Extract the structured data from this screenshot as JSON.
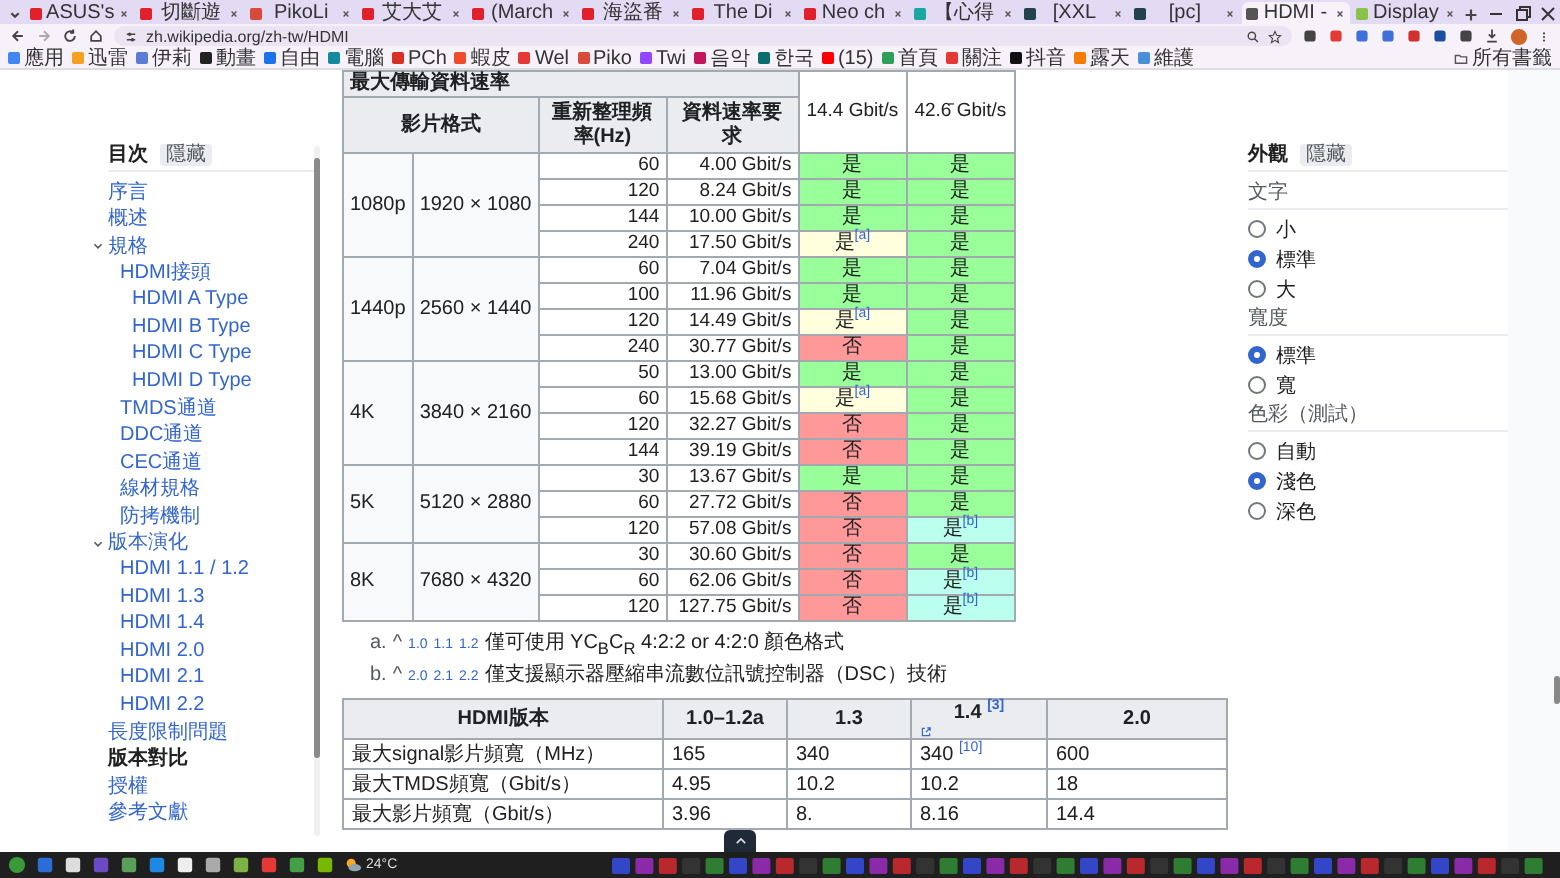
{
  "browser": {
    "tabs": [
      {
        "title": "ASUS's",
        "selected": false,
        "color": "#e0202a"
      },
      {
        "title": "切斷遊",
        "selected": false,
        "color": "#e0202a"
      },
      {
        "title": "PikoLi",
        "selected": false,
        "color": "#d84a3a"
      },
      {
        "title": "艾大艾",
        "selected": false,
        "color": "#e0202a"
      },
      {
        "title": "(March",
        "selected": false,
        "color": "#e0202a"
      },
      {
        "title": "海盜番",
        "selected": false,
        "color": "#e0202a"
      },
      {
        "title": "The Di",
        "selected": false,
        "color": "#e0202a"
      },
      {
        "title": "Neo ch",
        "selected": false,
        "color": "#e0202a"
      },
      {
        "title": "【心得",
        "selected": false,
        "color": "#1aa7a0"
      },
      {
        "title": "[XXL",
        "selected": false,
        "color": "#23424f"
      },
      {
        "title": "[pc]",
        "selected": false,
        "color": "#23424f"
      },
      {
        "title": "HDMI -",
        "selected": true,
        "color": "#555555"
      },
      {
        "title": "Display",
        "selected": false,
        "color": "#8bc34a"
      }
    ],
    "url": "zh.wikipedia.org/zh-tw/HDMI",
    "bookmarks": [
      {
        "label": "應用",
        "color": "#4285f4"
      },
      {
        "label": "迅雷",
        "color": "#f4a020"
      },
      {
        "label": "伊莉",
        "color": "#5b7bd5"
      },
      {
        "label": "動畫",
        "color": "#222222"
      },
      {
        "label": "自由",
        "color": "#1a73e8"
      },
      {
        "label": "電腦",
        "color": "#138a9e"
      },
      {
        "label": "PCh",
        "color": "#d93025"
      },
      {
        "label": "蝦皮",
        "color": "#ee4d2d"
      },
      {
        "label": "Wel",
        "color": "#e53935"
      },
      {
        "label": "Piko",
        "color": "#d84a3a"
      },
      {
        "label": "Twi",
        "color": "#9146ff"
      },
      {
        "label": "음악",
        "color": "#c2185b"
      },
      {
        "label": "한국",
        "color": "#0b6e6e"
      },
      {
        "label": "(15)",
        "color": "#ff0000"
      },
      {
        "label": "首頁",
        "color": "#2e9e5b"
      },
      {
        "label": "關注",
        "color": "#e53935"
      },
      {
        "label": "抖音",
        "color": "#111111"
      },
      {
        "label": "露天",
        "color": "#f57c00"
      },
      {
        "label": "維護",
        "color": "#4a90d9"
      }
    ],
    "all_bookmarks": "所有書籤"
  },
  "toc": {
    "title": "目次",
    "hide_button": "隱藏",
    "items": [
      {
        "label": "序言",
        "selected": false
      },
      {
        "label": "概述",
        "selected": false
      },
      {
        "label": "規格",
        "selected": false,
        "expanded": true,
        "children": [
          {
            "label": "HDMI接頭",
            "selected": false,
            "children": [
              {
                "label": "HDMI A Type",
                "selected": false
              },
              {
                "label": "HDMI B Type",
                "selected": false
              },
              {
                "label": "HDMI C Type",
                "selected": false
              },
              {
                "label": "HDMI D Type",
                "selected": false
              }
            ]
          },
          {
            "label": "TMDS通道",
            "selected": false
          },
          {
            "label": "DDC通道",
            "selected": false
          },
          {
            "label": "CEC通道",
            "selected": false
          },
          {
            "label": "線材規格",
            "selected": false
          },
          {
            "label": "防拷機制",
            "selected": false
          }
        ]
      },
      {
        "label": "版本演化",
        "selected": false,
        "expanded": true,
        "children": [
          {
            "label": "HDMI 1.1 / 1.2",
            "selected": false
          },
          {
            "label": "HDMI 1.3",
            "selected": false
          },
          {
            "label": "HDMI 1.4",
            "selected": false
          },
          {
            "label": "HDMI 2.0",
            "selected": false
          },
          {
            "label": "HDMI 2.1",
            "selected": false
          },
          {
            "label": "HDMI 2.2",
            "selected": false
          }
        ]
      },
      {
        "label": "長度限制問題",
        "selected": false
      },
      {
        "label": "版本對比",
        "selected": true
      },
      {
        "label": "授權",
        "selected": false
      },
      {
        "label": "參考文獻",
        "selected": false
      }
    ]
  },
  "rate_table": {
    "title": "最大傳輸資料速率",
    "format_header": "影片格式",
    "refresh_header": "重新整理頻率(Hz)",
    "rate_header": "資料速率要求",
    "bandwidths": [
      "14.4 Gbit/s",
      "42.6̄ Gbit/s"
    ],
    "groups": [
      {
        "format": "1080p",
        "resolution": "1920 × 1080",
        "rows": [
          {
            "hz": "60",
            "rate": "4.00 Gbit/s",
            "support": [
              {
                "text": "是",
                "color": "#99ff99"
              },
              {
                "text": "是",
                "color": "#99ff99"
              }
            ]
          },
          {
            "hz": "120",
            "rate": "8.24 Gbit/s",
            "support": [
              {
                "text": "是",
                "color": "#99ff99"
              },
              {
                "text": "是",
                "color": "#99ff99"
              }
            ]
          },
          {
            "hz": "144",
            "rate": "10.00 Gbit/s",
            "support": [
              {
                "text": "是",
                "color": "#99ff99"
              },
              {
                "text": "是",
                "color": "#99ff99"
              }
            ]
          },
          {
            "hz": "240",
            "rate": "17.50 Gbit/s",
            "support": [
              {
                "text": "是",
                "ref": "[a]",
                "color": "#ffffdd"
              },
              {
                "text": "是",
                "color": "#99ff99"
              }
            ]
          }
        ]
      },
      {
        "format": "1440p",
        "resolution": "2560 × 1440",
        "rows": [
          {
            "hz": "60",
            "rate": "7.04 Gbit/s",
            "support": [
              {
                "text": "是",
                "color": "#99ff99"
              },
              {
                "text": "是",
                "color": "#99ff99"
              }
            ]
          },
          {
            "hz": "100",
            "rate": "11.96 Gbit/s",
            "support": [
              {
                "text": "是",
                "color": "#99ff99"
              },
              {
                "text": "是",
                "color": "#99ff99"
              }
            ]
          },
          {
            "hz": "120",
            "rate": "14.49 Gbit/s",
            "support": [
              {
                "text": "是",
                "ref": "[a]",
                "color": "#ffffdd"
              },
              {
                "text": "是",
                "color": "#99ff99"
              }
            ]
          },
          {
            "hz": "240",
            "rate": "30.77 Gbit/s",
            "support": [
              {
                "text": "否",
                "color": "#ff9999"
              },
              {
                "text": "是",
                "color": "#99ff99"
              }
            ]
          }
        ]
      },
      {
        "format": "4K",
        "resolution": "3840 × 2160",
        "rows": [
          {
            "hz": "50",
            "rate": "13.00 Gbit/s",
            "support": [
              {
                "text": "是",
                "color": "#99ff99"
              },
              {
                "text": "是",
                "color": "#99ff99"
              }
            ]
          },
          {
            "hz": "60",
            "rate": "15.68 Gbit/s",
            "support": [
              {
                "text": "是",
                "ref": "[a]",
                "color": "#ffffdd"
              },
              {
                "text": "是",
                "color": "#99ff99"
              }
            ]
          },
          {
            "hz": "120",
            "rate": "32.27 Gbit/s",
            "support": [
              {
                "text": "否",
                "color": "#ff9999"
              },
              {
                "text": "是",
                "color": "#99ff99"
              }
            ]
          },
          {
            "hz": "144",
            "rate": "39.19 Gbit/s",
            "support": [
              {
                "text": "否",
                "color": "#ff9999"
              },
              {
                "text": "是",
                "color": "#99ff99"
              }
            ]
          }
        ]
      },
      {
        "format": "5K",
        "resolution": "5120 × 2880",
        "rows": [
          {
            "hz": "30",
            "rate": "13.67 Gbit/s",
            "support": [
              {
                "text": "是",
                "color": "#99ff99"
              },
              {
                "text": "是",
                "color": "#99ff99"
              }
            ]
          },
          {
            "hz": "60",
            "rate": "27.72 Gbit/s",
            "support": [
              {
                "text": "否",
                "color": "#ff9999"
              },
              {
                "text": "是",
                "color": "#99ff99"
              }
            ]
          },
          {
            "hz": "120",
            "rate": "57.08 Gbit/s",
            "support": [
              {
                "text": "否",
                "color": "#ff9999"
              },
              {
                "text": "是",
                "ref": "[b]",
                "color": "#bbffee"
              }
            ]
          }
        ]
      },
      {
        "format": "8K",
        "resolution": "7680 × 4320",
        "rows": [
          {
            "hz": "30",
            "rate": "30.60 Gbit/s",
            "support": [
              {
                "text": "否",
                "color": "#ff9999"
              },
              {
                "text": "是",
                "color": "#99ff99"
              }
            ]
          },
          {
            "hz": "60",
            "rate": "62.06 Gbit/s",
            "support": [
              {
                "text": "否",
                "color": "#ff9999"
              },
              {
                "text": "是",
                "ref": "[b]",
                "color": "#bbffee"
              }
            ]
          },
          {
            "hz": "120",
            "rate": "127.75 Gbit/s",
            "support": [
              {
                "text": "否",
                "color": "#ff9999"
              },
              {
                "text": "是",
                "ref": "[b]",
                "color": "#bbffee"
              }
            ]
          }
        ]
      }
    ]
  },
  "notes": [
    {
      "marker": "a.",
      "caret": "^",
      "backlinks": [
        "1.0",
        "1.1",
        "1.2"
      ],
      "text": "僅可使用 YC$_{B}$C$_{R}$ 4:2:2 or 4:2:0 顏色格式"
    },
    {
      "marker": "b.",
      "caret": "^",
      "backlinks": [
        "2.0",
        "2.1",
        "2.2"
      ],
      "text": "僅支援顯示器壓縮串流數位訊號控制器（DSC）技術"
    }
  ],
  "version_table": {
    "columns": [
      {
        "label": "HDMI版本"
      },
      {
        "label": "1.0–1.2a"
      },
      {
        "label": "1.3"
      },
      {
        "label": "1.4",
        "ref": "[3]"
      },
      {
        "label": "2.0"
      }
    ],
    "rows": [
      [
        {
          "text": "最大signal影片頻寬（MHz）"
        },
        {
          "text": "165"
        },
        {
          "text": "340"
        },
        {
          "text": "340",
          "ref": "[10]"
        },
        {
          "text": "600"
        }
      ],
      [
        {
          "text": "最大TMDS頻寬（Gbit/s）"
        },
        {
          "text": "4.95"
        },
        {
          "text": "10.2"
        },
        {
          "text": "10.2"
        },
        {
          "text": "18"
        }
      ],
      [
        {
          "text": "最大影片頻寬（Gbit/s）"
        },
        {
          "text": "3.96"
        },
        {
          "text": "8."
        },
        {
          "text": "8.16"
        },
        {
          "text": "14.4"
        }
      ]
    ]
  },
  "appearance": {
    "title": "外觀",
    "hide_button": "隱藏",
    "groups": [
      {
        "label": "文字",
        "options": [
          {
            "label": "小",
            "selected": false
          },
          {
            "label": "標準",
            "selected": true
          },
          {
            "label": "大",
            "selected": false
          }
        ]
      },
      {
        "label": "寬度",
        "options": [
          {
            "label": "標準",
            "selected": true
          },
          {
            "label": "寬",
            "selected": false
          }
        ]
      },
      {
        "label": "色彩（測試）",
        "options": [
          {
            "label": "自動",
            "selected": false
          },
          {
            "label": "淺色",
            "selected": true
          },
          {
            "label": "深色",
            "selected": false
          }
        ]
      }
    ]
  },
  "taskbar": {
    "weather": "24°C"
  }
}
